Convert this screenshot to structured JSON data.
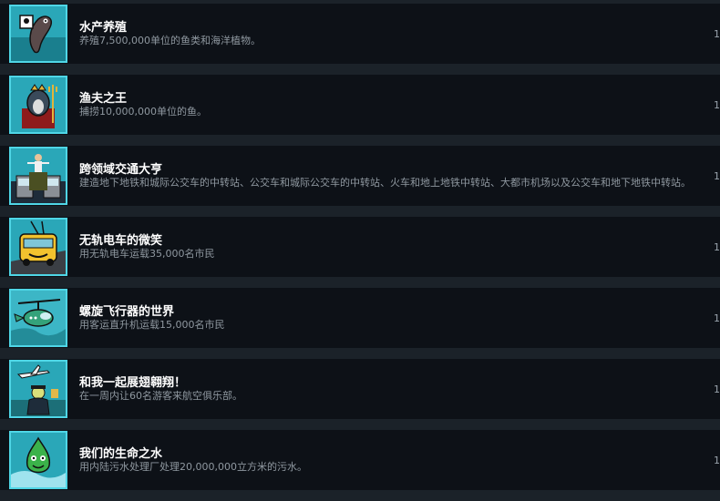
{
  "achievements": [
    {
      "title": "水产养殖",
      "desc": "养殖7,500,000单位的鱼类和海洋植物。",
      "status": "1",
      "icon": "fish-icon"
    },
    {
      "title": "渔夫之王",
      "desc": "捕捞10,000,000单位的鱼。",
      "status": "1",
      "icon": "fisher-king-icon"
    },
    {
      "title": "跨领域交通大亨",
      "desc": "建造地下地铁和城际公交车的中转站、公交车和城际公交车的中转站、火车和地上地铁中转站、大都市机场以及公交车和地下地铁中转站。",
      "status": "1",
      "icon": "transport-tycoon-icon"
    },
    {
      "title": "无轨电车的微笑",
      "desc": "用无轨电车运载35,000名市民",
      "status": "1",
      "icon": "trolleybus-icon"
    },
    {
      "title": "螺旋飞行器的世界",
      "desc": "用客运直升机运载15,000名市民",
      "status": "1",
      "icon": "helicopter-icon"
    },
    {
      "title": "和我一起展翅翱翔！",
      "desc": "在一周内让60名游客来航空俱乐部。",
      "status": "1",
      "icon": "airplane-club-icon"
    },
    {
      "title": "我们的生命之水",
      "desc": "用内陆污水处理厂处理20,000,000立方米的污水。",
      "status": "1",
      "icon": "water-drop-icon"
    }
  ],
  "colors": {
    "row_bg": "#0d1117",
    "gap_bg": "#1b2229",
    "icon_border": "#4fd6e6",
    "title": "#ffffff",
    "desc": "#8f98a0"
  }
}
